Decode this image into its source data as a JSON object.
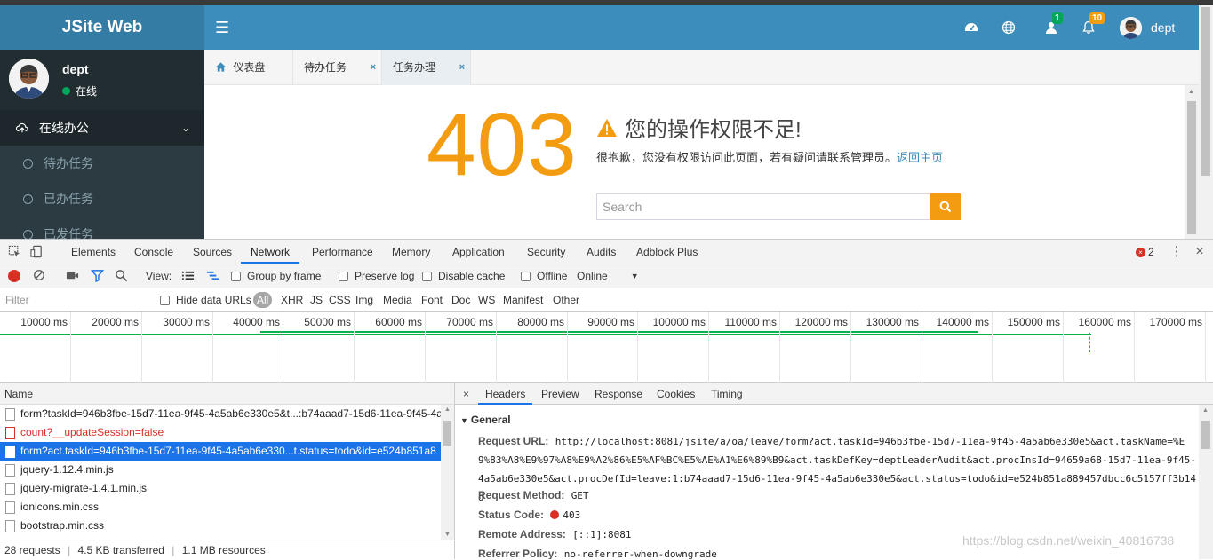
{
  "app": {
    "brand": "JSite Web",
    "user": {
      "name": "dept",
      "status": "在线"
    },
    "nav": {
      "badge_messages": "1",
      "badge_notifications": "10",
      "username": "dept"
    },
    "sidebar": {
      "group": "在线办公",
      "items": [
        {
          "label": "待办任务"
        },
        {
          "label": "已办任务"
        },
        {
          "label": "已发任务"
        }
      ]
    },
    "tabs": [
      {
        "label": "仪表盘"
      },
      {
        "label": "待办任务"
      },
      {
        "label": "任务办理"
      }
    ],
    "error": {
      "code": "403",
      "title": "您的操作权限不足!",
      "desc": "很抱歉，您没有权限访问此页面，若有疑问请联系管理员。",
      "back_link": "返回主页",
      "search_placeholder": "Search"
    }
  },
  "devtools": {
    "tabs": [
      "Elements",
      "Console",
      "Sources",
      "Network",
      "Performance",
      "Memory",
      "Application",
      "Security",
      "Audits",
      "Adblock Plus"
    ],
    "active_tab": "Network",
    "error_count": "2",
    "toolbar": {
      "view": "View:",
      "group_by_frame": "Group by frame",
      "preserve_log": "Preserve log",
      "disable_cache": "Disable cache",
      "offline": "Offline",
      "throttle": "Online"
    },
    "filter": {
      "placeholder": "Filter",
      "hide_data_urls": "Hide data URLs",
      "types": [
        "All",
        "XHR",
        "JS",
        "CSS",
        "Img",
        "Media",
        "Font",
        "Doc",
        "WS",
        "Manifest",
        "Other"
      ]
    },
    "timeline_ticks": [
      "10000 ms",
      "20000 ms",
      "30000 ms",
      "40000 ms",
      "50000 ms",
      "60000 ms",
      "70000 ms",
      "80000 ms",
      "90000 ms",
      "100000 ms",
      "110000 ms",
      "120000 ms",
      "130000 ms",
      "140000 ms",
      "150000 ms",
      "160000 ms",
      "170000 ms"
    ],
    "names_header": "Name",
    "requests": [
      {
        "name": "form?taskId=946b3fbe-15d7-11ea-9f45-4a5ab6e330e5&t...:b74aaad7-15d6-11ea-9f45-4a",
        "state": "normal"
      },
      {
        "name": "count?__updateSession=false",
        "state": "error"
      },
      {
        "name": "form?act.taskId=946b3fbe-15d7-11ea-9f45-4a5ab6e330...t.status=todo&id=e524b851a8",
        "state": "selected"
      },
      {
        "name": "jquery-1.12.4.min.js",
        "state": "normal"
      },
      {
        "name": "jquery-migrate-1.4.1.min.js",
        "state": "normal"
      },
      {
        "name": "ionicons.min.css",
        "state": "normal"
      },
      {
        "name": "bootstrap.min.css",
        "state": "normal"
      }
    ],
    "summary": {
      "requests": "28 requests",
      "transferred": "4.5 KB transferred",
      "resources": "1.1 MB resources"
    },
    "detail_tabs": [
      "Headers",
      "Preview",
      "Response",
      "Cookies",
      "Timing"
    ],
    "general": {
      "title": "General",
      "request_url_label": "Request URL:",
      "request_url": "http://localhost:8081/jsite/a/oa/leave/form?act.taskId=946b3fbe-15d7-11ea-9f45-4a5ab6e330e5&act.taskName=%E9%83%A8%E9%97%A8%E9%A2%86%E5%AF%BC%E5%AE%A1%E6%89%B9&act.taskDefKey=deptLeaderAudit&act.procInsId=94659a68-15d7-11ea-9f45-4a5ab6e330e5&act.procDefId=leave:1:b74aaad7-15d6-11ea-9f45-4a5ab6e330e5&act.status=todo&id=e524b851a889457dbcc6c5157ff3b14d",
      "request_method_label": "Request Method:",
      "request_method": "GET",
      "status_code_label": "Status Code:",
      "status_code": "403",
      "remote_address_label": "Remote Address:",
      "remote_address": "[::1]:8081",
      "referrer_policy_label": "Referrer Policy:",
      "referrer_policy": "no-referrer-when-downgrade"
    },
    "watermark": "https://blog.csdn.net/weixin_40816738"
  }
}
